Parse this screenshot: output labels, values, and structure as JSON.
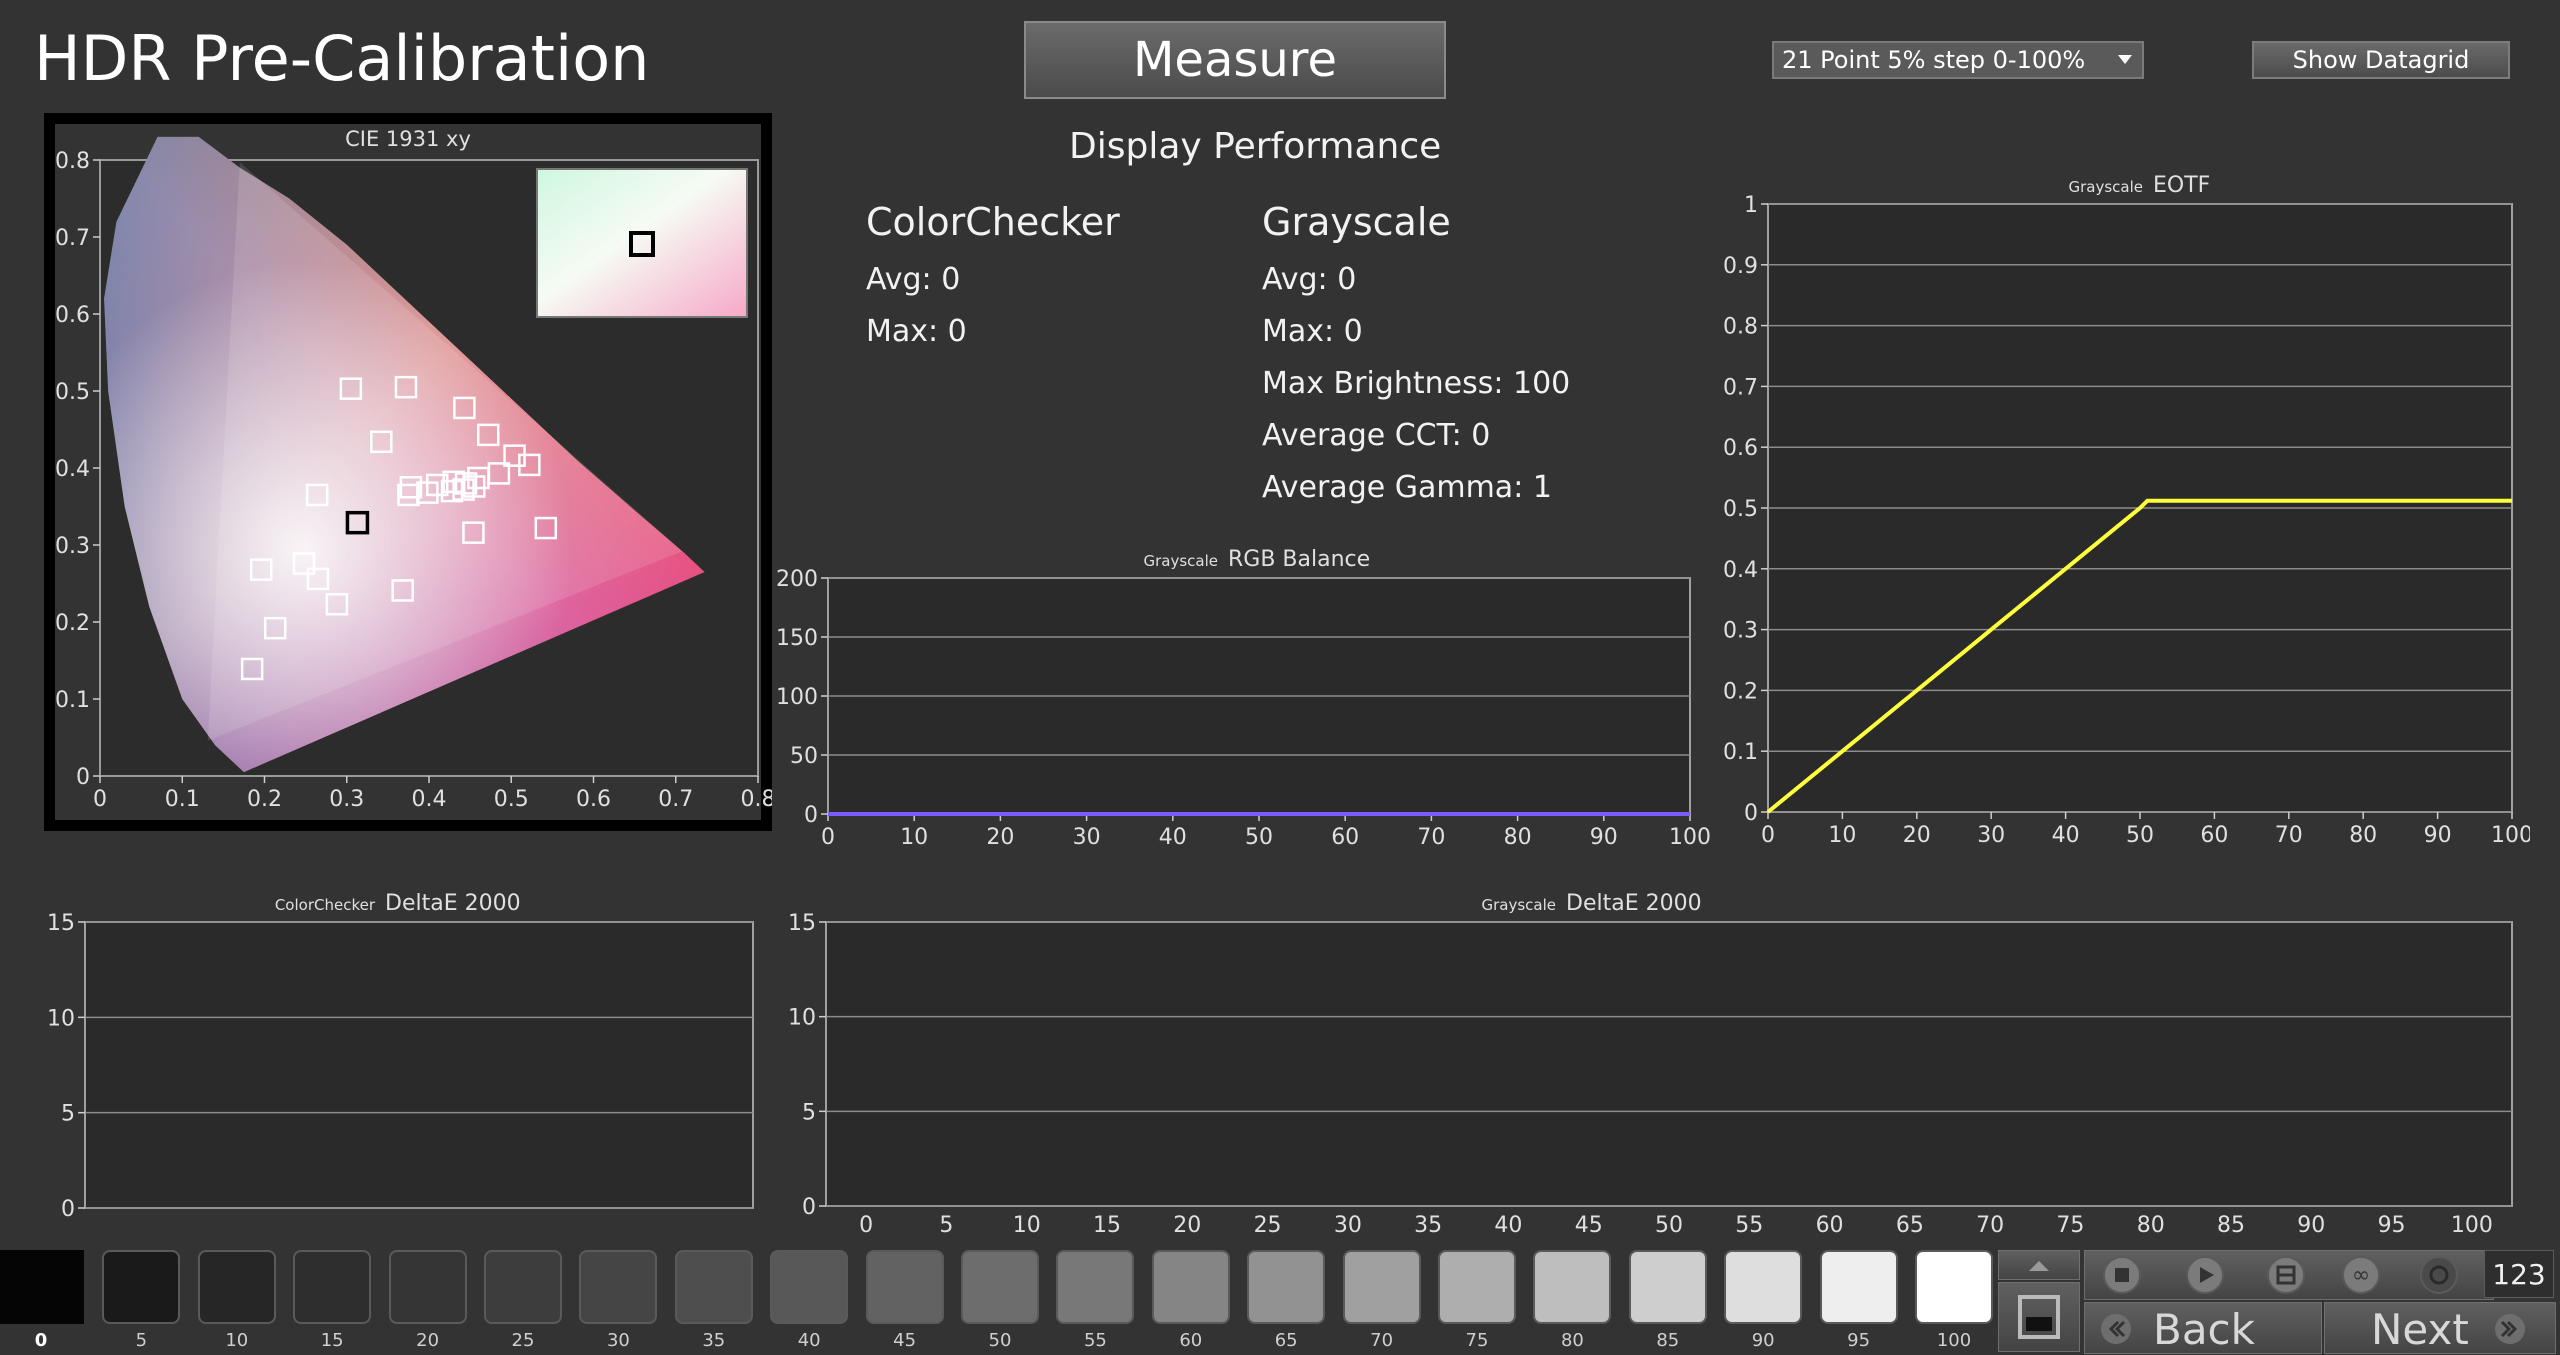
{
  "header": {
    "title": "HDR Pre-Calibration",
    "measure_label": "Measure",
    "sequence_selected": "21 Point 5% step 0-100%",
    "show_datagrid_label": "Show Datagrid"
  },
  "performance": {
    "title": "Display Performance",
    "colorchecker": {
      "heading": "ColorChecker",
      "avg": "Avg: 0",
      "max": "Max: 0"
    },
    "grayscale": {
      "heading": "Grayscale",
      "avg": "Avg: 0",
      "max": "Max: 0",
      "max_brightness": "Max Brightness: 100",
      "average_cct": "Average CCT: 0",
      "average_gamma": "Average Gamma: 1"
    }
  },
  "colors": {
    "background": "#333333",
    "eotf_line": "#ffff3c",
    "rgb_line": "#7a5cff",
    "grid": "#8c8c8c"
  },
  "footer": {
    "swatches": [
      "0",
      "5",
      "10",
      "15",
      "20",
      "25",
      "30",
      "35",
      "40",
      "45",
      "50",
      "55",
      "60",
      "65",
      "70",
      "75",
      "80",
      "85",
      "90",
      "95",
      "100"
    ],
    "swatch_grays": [
      "#050505",
      "#1a1a1a",
      "#262626",
      "#2e2e2e",
      "#353535",
      "#3d3d3d",
      "#454545",
      "#4e4e4e",
      "#585858",
      "#626262",
      "#6d6d6d",
      "#787878",
      "#858585",
      "#929292",
      "#a0a0a0",
      "#aeaeae",
      "#bebebe",
      "#cecece",
      "#dedede",
      "#eeeeee",
      "#ffffff"
    ],
    "counter": "123",
    "back_label": "Back",
    "next_label": "Next",
    "icons": [
      "stop-icon",
      "play-icon",
      "film-icon",
      "infinity-icon",
      "refresh-icon",
      "up-arrow-icon",
      "single-frame-icon",
      "double-chevron-left-icon",
      "double-chevron-right-icon"
    ]
  },
  "chart_data": [
    {
      "type": "scatter",
      "title": "CIE 1931 xy",
      "xlim": [
        0,
        0.8
      ],
      "ylim": [
        0,
        0.8
      ],
      "x_ticks": [
        "0",
        "0.1",
        "0.2",
        "0.3",
        "0.4",
        "0.5",
        "0.6",
        "0.7",
        "0.8"
      ],
      "y_ticks": [
        "0",
        "0.1",
        "0.2",
        "0.3",
        "0.4",
        "0.5",
        "0.6",
        "0.7",
        "0.8"
      ],
      "points": [
        [
          0.305,
          0.503
        ],
        [
          0.372,
          0.505
        ],
        [
          0.443,
          0.478
        ],
        [
          0.472,
          0.443
        ],
        [
          0.504,
          0.416
        ],
        [
          0.522,
          0.404
        ],
        [
          0.485,
          0.393
        ],
        [
          0.46,
          0.387
        ],
        [
          0.445,
          0.38
        ],
        [
          0.43,
          0.382
        ],
        [
          0.41,
          0.378
        ],
        [
          0.398,
          0.368
        ],
        [
          0.375,
          0.365
        ],
        [
          0.378,
          0.375
        ],
        [
          0.428,
          0.37
        ],
        [
          0.442,
          0.372
        ],
        [
          0.455,
          0.376
        ],
        [
          0.342,
          0.434
        ],
        [
          0.264,
          0.365
        ],
        [
          0.454,
          0.316
        ],
        [
          0.542,
          0.322
        ],
        [
          0.248,
          0.276
        ],
        [
          0.265,
          0.256
        ],
        [
          0.288,
          0.223
        ],
        [
          0.368,
          0.241
        ],
        [
          0.196,
          0.268
        ],
        [
          0.213,
          0.192
        ],
        [
          0.185,
          0.139
        ]
      ],
      "target_point": [
        0.313,
        0.329
      ],
      "inset_point": "target"
    },
    {
      "type": "line",
      "title": "RGB Balance",
      "subtitle": "Grayscale",
      "x_ticks": [
        "0",
        "10",
        "20",
        "30",
        "40",
        "50",
        "60",
        "70",
        "80",
        "90",
        "100"
      ],
      "y_ticks": [
        "0",
        "50",
        "100",
        "150",
        "200"
      ],
      "xlim": [
        0,
        100
      ],
      "ylim": [
        0,
        200
      ],
      "series": [
        {
          "x": [
            0,
            100
          ],
          "values": [
            0,
            0
          ]
        }
      ]
    },
    {
      "type": "line",
      "title": "EOTF",
      "subtitle": "Grayscale",
      "x_ticks": [
        "0",
        "10",
        "20",
        "30",
        "40",
        "50",
        "60",
        "70",
        "80",
        "90",
        "100"
      ],
      "y_ticks": [
        "0",
        "0.1",
        "0.2",
        "0.3",
        "0.4",
        "0.5",
        "0.6",
        "0.7",
        "0.8",
        "0.9",
        "1"
      ],
      "xlim": [
        0,
        100
      ],
      "ylim": [
        0,
        1
      ],
      "series": [
        {
          "x": [
            0,
            10,
            20,
            30,
            40,
            50,
            51,
            60,
            70,
            80,
            90,
            100
          ],
          "values": [
            0,
            0.1,
            0.2,
            0.3,
            0.4,
            0.5,
            0.512,
            0.512,
            0.512,
            0.512,
            0.512,
            0.512
          ]
        }
      ]
    },
    {
      "type": "bar",
      "title": "DeltaE 2000",
      "subtitle": "ColorChecker",
      "y_ticks": [
        "0",
        "5",
        "10",
        "15"
      ],
      "ylim": [
        0,
        15
      ],
      "values": []
    },
    {
      "type": "bar",
      "title": "DeltaE 2000",
      "subtitle": "Grayscale",
      "x_ticks": [
        "0",
        "5",
        "10",
        "15",
        "20",
        "25",
        "30",
        "35",
        "40",
        "45",
        "50",
        "55",
        "60",
        "65",
        "70",
        "75",
        "80",
        "85",
        "90",
        "95",
        "100"
      ],
      "y_ticks": [
        "0",
        "5",
        "10",
        "15"
      ],
      "ylim": [
        0,
        15
      ],
      "values": []
    }
  ]
}
